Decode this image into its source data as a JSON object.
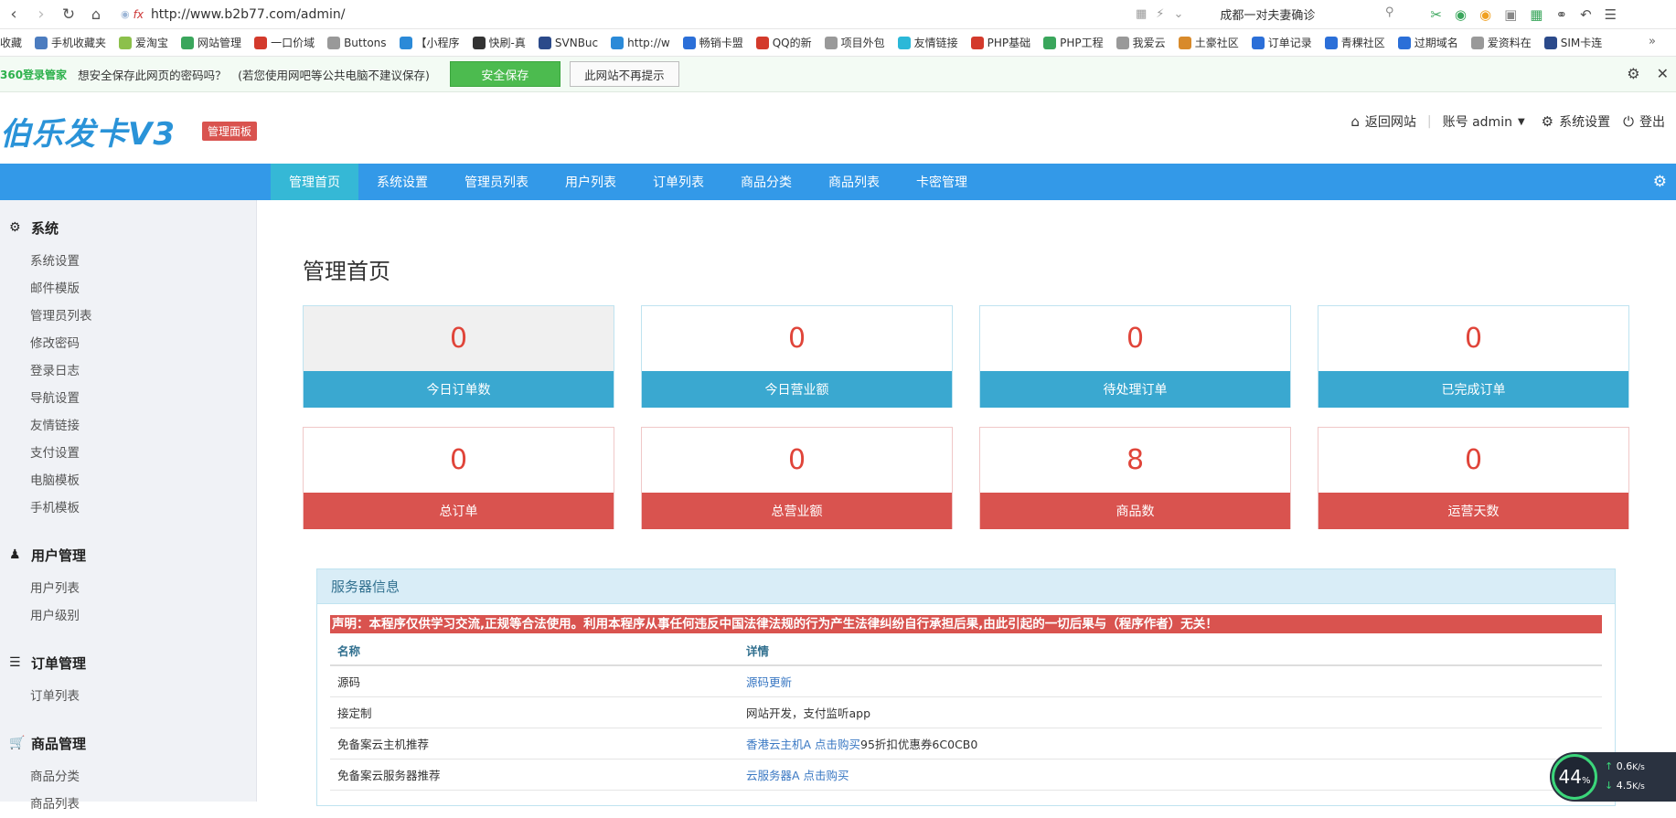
{
  "browser": {
    "url": "http://www.b2b77.com/admin/",
    "search_text": "成都一对夫妻确诊",
    "bookmarks": [
      {
        "label": "收藏",
        "color": "#888888"
      },
      {
        "label": "手机收藏夹",
        "color": "#4c7cbf"
      },
      {
        "label": "爱淘宝",
        "color": "#8cc04b"
      },
      {
        "label": "网站管理",
        "color": "#3aa65c"
      },
      {
        "label": "一口价域",
        "color": "#d33a2c"
      },
      {
        "label": "Buttons",
        "color": "#999999"
      },
      {
        "label": "【小程序",
        "color": "#2b8ad8"
      },
      {
        "label": "快刷-真",
        "color": "#333333"
      },
      {
        "label": "SVNBuc",
        "color": "#2b4a8a"
      },
      {
        "label": "http://w",
        "color": "#2b8ad8"
      },
      {
        "label": "畅销卡盟",
        "color": "#2b6fd8"
      },
      {
        "label": "QQ的新",
        "color": "#d33a2c"
      },
      {
        "label": "项目外包",
        "color": "#999999"
      },
      {
        "label": "友情链接",
        "color": "#2bb8d8"
      },
      {
        "label": "PHP基础",
        "color": "#d33a2c"
      },
      {
        "label": "PHP工程",
        "color": "#3aa65c"
      },
      {
        "label": "我爱云",
        "color": "#999999"
      },
      {
        "label": "土豪社区",
        "color": "#d88a2b"
      },
      {
        "label": "订单记录",
        "color": "#2b6fd8"
      },
      {
        "label": "青稞社区",
        "color": "#2b6fd8"
      },
      {
        "label": "过期域名",
        "color": "#2b6fd8"
      },
      {
        "label": "爱资料在",
        "color": "#999999"
      },
      {
        "label": "SIM卡连",
        "color": "#2b4a8a"
      }
    ],
    "password_bar": {
      "brand": "360登录管家",
      "message": "想安全保存此网页的密码吗？　(若您使用网吧等公共电脑不建议保存)",
      "save_label": "安全保存",
      "never_label": "此网站不再提示"
    }
  },
  "header": {
    "logo": "伯乐发卡V3",
    "badge": "管理面板",
    "back_label": "返回网站",
    "account_label": "账号 admin",
    "settings_label": "系统设置",
    "logout_label": "登出"
  },
  "topnav": [
    "管理首页",
    "系统设置",
    "管理员列表",
    "用户列表",
    "订单列表",
    "商品分类",
    "商品列表",
    "卡密管理"
  ],
  "sidebar": {
    "groups": [
      {
        "title": "系统",
        "icon": "gear-icon",
        "items": [
          "系统设置",
          "邮件模版",
          "管理员列表",
          "修改密码",
          "登录日志",
          "导航设置",
          "友情链接",
          "支付设置",
          "电脑模板",
          "手机模板"
        ]
      },
      {
        "title": "用户管理",
        "icon": "user-icon",
        "items": [
          "用户列表",
          "用户级别"
        ]
      },
      {
        "title": "订单管理",
        "icon": "list-icon",
        "items": [
          "订单列表"
        ]
      },
      {
        "title": "商品管理",
        "icon": "cart-icon",
        "items": [
          "商品分类",
          "商品列表"
        ]
      }
    ]
  },
  "main": {
    "title": "管理首页",
    "stats": [
      {
        "value": "0",
        "label": "今日订单数"
      },
      {
        "value": "0",
        "label": "今日营业额"
      },
      {
        "value": "0",
        "label": "待处理订单"
      },
      {
        "value": "0",
        "label": "已完成订单"
      },
      {
        "value": "0",
        "label": "总订单"
      },
      {
        "value": "0",
        "label": "总营业额"
      },
      {
        "value": "8",
        "label": "商品数"
      },
      {
        "value": "0",
        "label": "运营天数"
      }
    ],
    "server_panel": {
      "title": "服务器信息",
      "notice": "声明：本程序仅供学习交流,正规等合法使用。利用本程序从事任何违反中国法律法规的行为产生法律纠纷自行承担后果,由此引起的一切后果与（程序作者）无关！",
      "columns": [
        "名称",
        "详情"
      ],
      "rows": [
        {
          "name": "源码",
          "link": "源码更新",
          "text": ""
        },
        {
          "name": "接定制",
          "link": "",
          "text": "网站开发，支付监听app"
        },
        {
          "name": "免备案云主机推荐",
          "link": "香港云主机A 点击购买",
          "text": "95折扣优惠券6C0CB0"
        },
        {
          "name": "免备案云服务器推荐",
          "link": "云服务器A 点击购买",
          "text": ""
        }
      ]
    }
  },
  "speed_widget": {
    "percent": "44",
    "unit": "%",
    "up": "0.6",
    "down": "4.5",
    "rate_unit": "K/s"
  }
}
